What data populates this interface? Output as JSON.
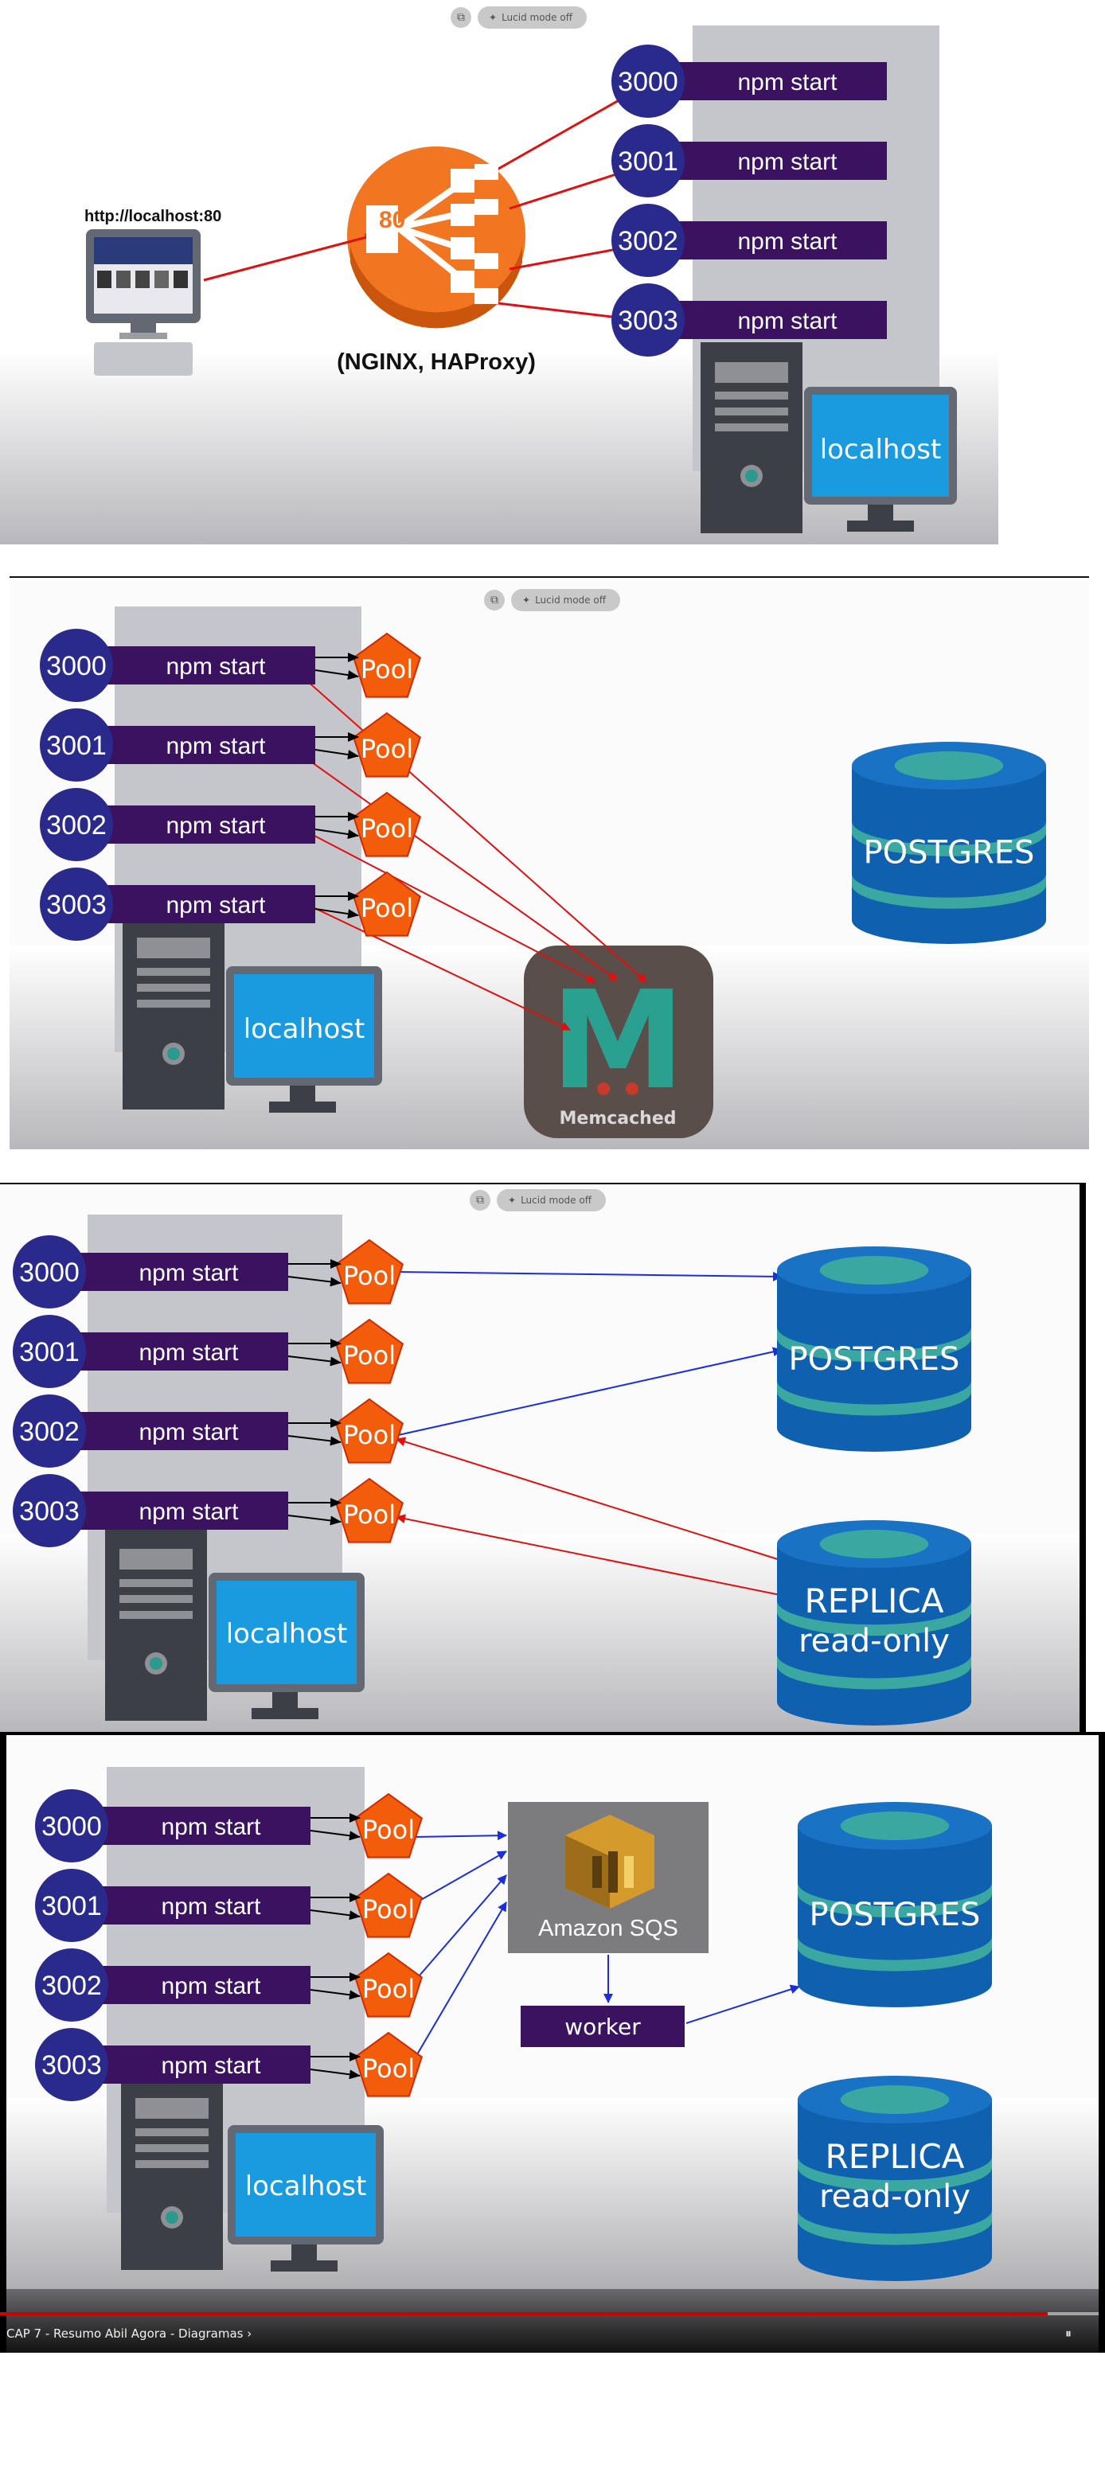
{
  "toolbar": {
    "lucid_label": "Lucid mode off",
    "copy_icon": "copy-icon",
    "sparkle_icon": "sparkle-icon"
  },
  "panel1": {
    "url": "http://localhost:80",
    "balancer_port": "80",
    "balancer_label": "(NGINX, HAProxy)",
    "instances": [
      {
        "port": "3000",
        "label": "npm start"
      },
      {
        "port": "3001",
        "label": "npm start"
      },
      {
        "port": "3002",
        "label": "npm start"
      },
      {
        "port": "3003",
        "label": "npm start"
      }
    ],
    "monitor_label": "localhost"
  },
  "panel2": {
    "instances": [
      {
        "port": "3000",
        "label": "npm start",
        "pool": "Pool"
      },
      {
        "port": "3001",
        "label": "npm start",
        "pool": "Pool"
      },
      {
        "port": "3002",
        "label": "npm start",
        "pool": "Pool"
      },
      {
        "port": "3003",
        "label": "npm start",
        "pool": "Pool"
      }
    ],
    "monitor_label": "localhost",
    "cache_label": "Memcached",
    "cache_letter": "M",
    "db_label": "POSTGRES"
  },
  "panel3": {
    "instances": [
      {
        "port": "3000",
        "label": "npm start",
        "pool": "Pool"
      },
      {
        "port": "3001",
        "label": "npm start",
        "pool": "Pool"
      },
      {
        "port": "3002",
        "label": "npm start",
        "pool": "Pool"
      },
      {
        "port": "3003",
        "label": "npm start",
        "pool": "Pool"
      }
    ],
    "monitor_label": "localhost",
    "db_label": "POSTGRES",
    "replica_line1": "REPLICA",
    "replica_line2": "read-only"
  },
  "panel4": {
    "instances": [
      {
        "port": "3000",
        "label": "npm start",
        "pool": "Pool"
      },
      {
        "port": "3001",
        "label": "npm start",
        "pool": "Pool"
      },
      {
        "port": "3002",
        "label": "npm start",
        "pool": "Pool"
      },
      {
        "port": "3003",
        "label": "npm start",
        "pool": "Pool"
      }
    ],
    "monitor_label": "localhost",
    "queue_label": "Amazon SQS",
    "worker_label": "worker",
    "db_label": "POSTGRES",
    "replica_line1": "REPLICA",
    "replica_line2": "read-only"
  },
  "player": {
    "title": "CAP 7 - Resumo Abil Agora - Diagramas",
    "chevron": "›",
    "progress": 0.948
  },
  "colors": {
    "instance_circle": "#2a2a8c",
    "instance_bar": "#3b1260",
    "pool": "#f25c0a",
    "balancer": "#f27521",
    "db": "#1060b0",
    "db_band": "#3aa8a0",
    "arrow_red": "#e01010",
    "arrow_blue": "#1a2ee0"
  }
}
